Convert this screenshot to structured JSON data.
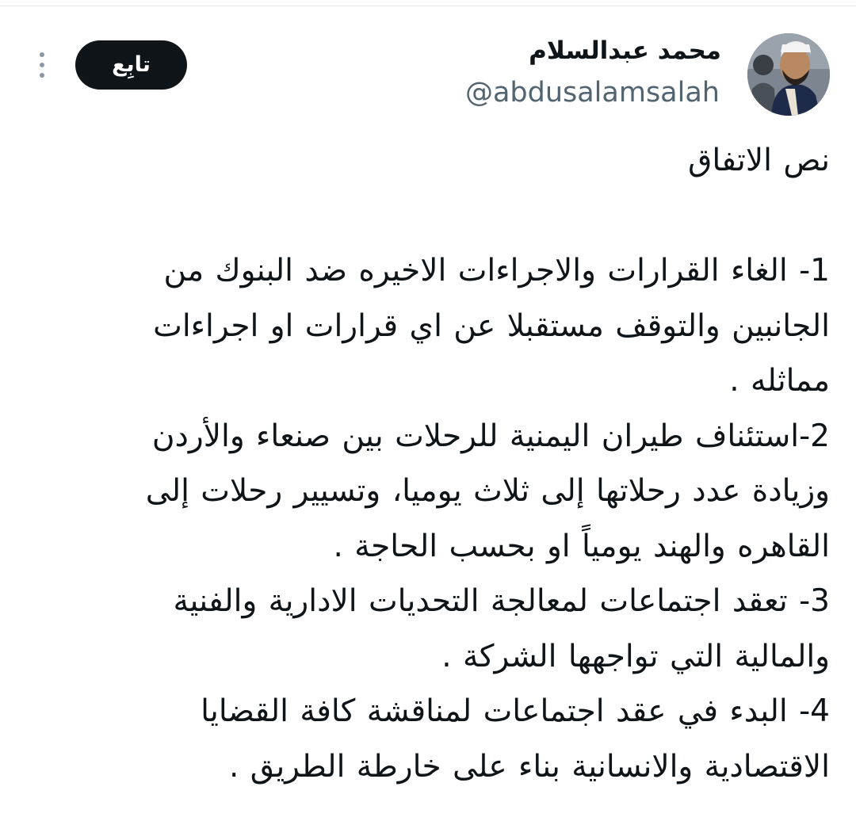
{
  "author": {
    "name": "محمد عبدالسلام",
    "handle": "@abdusalamsalah",
    "avatar_icon": "profile-photo"
  },
  "actions": {
    "follow_label": "تابِع",
    "more_icon": "more-vertical-icon"
  },
  "tweet": {
    "lines": [
      "نص الاتفاق",
      "",
      "1- الغاء القرارات والاجراءات الاخيره ضد البنوك من",
      "الجانبين والتوقف مستقبلا عن اي قرارات او اجراءات",
      "مماثله .",
      "2-استئناف طيران اليمنية للرحلات بين صنعاء والأردن",
      "وزيادة عدد رحلاتها إلى ثلاث يوميا، وتسيير رحلات إلى",
      "القاهره والهند يومياً او بحسب الحاجة .",
      "3- تعقد اجتماعات لمعالجة التحديات الادارية والفنية",
      "والمالية التي تواجهها الشركة .",
      " 4- البدء في عقد اجتماعات لمناقشة كافة القضايا",
      "الاقتصادية والانسانية بناء على خارطة الطريق ."
    ]
  },
  "colors": {
    "text": "#0f1419",
    "secondary": "#536471",
    "button_bg": "#0f1419",
    "button_text": "#ffffff"
  }
}
